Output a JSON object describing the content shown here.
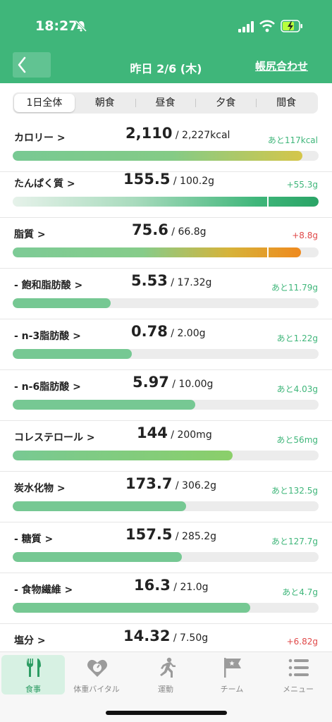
{
  "status": {
    "time": "18:27"
  },
  "header": {
    "title": "昨日 2/6 (木)",
    "adjust_label": "帳尻合わせ"
  },
  "meal_tabs": [
    "1日全体",
    "朝食",
    "昼食",
    "夕食",
    "間食"
  ],
  "active_tab": 0,
  "colors": {
    "brand": "#3fb67a",
    "over": "#e04848",
    "track": "#ececec"
  },
  "nutrients": [
    {
      "label": "カロリー >",
      "value": "2,110",
      "target": " / 2,227kcal",
      "remain": "あと117kcal",
      "progress": 0.947,
      "over": false
    },
    {
      "label": "たんぱく質 >",
      "value": "155.5",
      "target": " / 100.2g",
      "remain": "+55.3g",
      "progress": 1.0,
      "over": true,
      "status_color": "green"
    },
    {
      "label": "脂質 >",
      "value": "75.6",
      "target": " / 66.8g",
      "remain": "+8.8g",
      "progress": 1.0,
      "over": true,
      "status_color": "red"
    },
    {
      "label": "- 飽和脂肪酸 >",
      "value": "5.53",
      "target": " / 17.32g",
      "remain": "あと11.79g",
      "progress": 0.32,
      "over": false
    },
    {
      "label": "- n-3脂肪酸 >",
      "value": "0.78",
      "target": " / 2.00g",
      "remain": "あと1.22g",
      "progress": 0.39,
      "over": false
    },
    {
      "label": "- n-6脂肪酸 >",
      "value": "5.97",
      "target": " / 10.00g",
      "remain": "あと4.03g",
      "progress": 0.597,
      "over": false
    },
    {
      "label": "コレステロール >",
      "value": "144",
      "target": " / 200mg",
      "remain": "あと56mg",
      "progress": 0.72,
      "over": false
    },
    {
      "label": "炭水化物 >",
      "value": "173.7",
      "target": " / 306.2g",
      "remain": "あと132.5g",
      "progress": 0.567,
      "over": false
    },
    {
      "label": "- 糖質 >",
      "value": "157.5",
      "target": " / 285.2g",
      "remain": "あと127.7g",
      "progress": 0.552,
      "over": false
    },
    {
      "label": "- 食物繊維 >",
      "value": "16.3",
      "target": " / 21.0g",
      "remain": "あと4.7g",
      "progress": 0.776,
      "over": false
    },
    {
      "label": "塩分 >",
      "value": "14.32",
      "target": " / 7.50g",
      "remain": "+6.82g",
      "progress": 1.0,
      "over": true,
      "status_color": "red"
    }
  ],
  "tabbar": [
    {
      "label": "食事",
      "icon": "meal-icon"
    },
    {
      "label": "体重バイタル",
      "icon": "heart-icon"
    },
    {
      "label": "運動",
      "icon": "runner-icon"
    },
    {
      "label": "チーム",
      "icon": "flag-icon"
    },
    {
      "label": "メニュー",
      "icon": "menu-icon"
    }
  ],
  "active_bottom_tab": 0
}
